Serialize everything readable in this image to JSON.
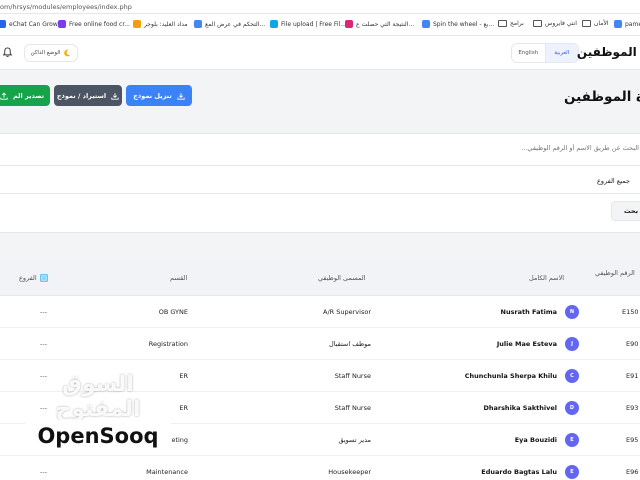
{
  "browser": {
    "url": "om/hrsys/modules/employees/index.php",
    "bookmarks": [
      {
        "label": "eChat Can Grow...",
        "icon": "page-icon",
        "color": "#2563eb"
      },
      {
        "label": "Free online food cr...",
        "icon": "bird-icon",
        "color": "#7c3aed"
      },
      {
        "label": "مداد العليد: بلوجر",
        "icon": "page-icon",
        "color": "#f59e0b"
      },
      {
        "label": "التحكم في عرض المع...",
        "icon": "google-icon",
        "color": "#4285f4"
      },
      {
        "label": "File upload | Free Fil...",
        "icon": "page-icon",
        "color": "#0ea5e9"
      },
      {
        "label": "النتيجة التي حصلت ع...",
        "icon": "page-icon",
        "color": "#db2777"
      },
      {
        "label": "Spin the wheel - بع...",
        "icon": "google-icon",
        "color": "#4285f4"
      },
      {
        "label": "برامج",
        "icon": "folder-icon",
        "color": "#555555"
      },
      {
        "label": "انتي فايروس",
        "icon": "folder-icon",
        "color": "#555555"
      },
      {
        "label": "الأمان",
        "icon": "folder-icon",
        "color": "#555555"
      },
      {
        "label": "pame",
        "icon": "google-icon",
        "color": "#4285f4"
      }
    ]
  },
  "header": {
    "title": "ة الموظفين",
    "dark_mode_label": "الوضع الداكن",
    "lang_english": "English",
    "lang_arabic": "العربية"
  },
  "actions": {
    "export_label": "تصدير الم",
    "import_label": "استيراد / نموذج",
    "download_label": "تنزيل نموذج"
  },
  "page": {
    "title": "ة الموظفين"
  },
  "filters": {
    "search_placeholder": "البحث عن طريق الاسم أو الرقم الوظيفي...",
    "branch_value": "جميع الفروع",
    "search_button": "بحث"
  },
  "table": {
    "headers": {
      "empno": "الرقم الوظيفي",
      "name": "الاسم الكامل",
      "title": "المسمى الوظيفي",
      "dept": "القسم",
      "branches": "الفروع"
    },
    "rows": [
      {
        "empno": "E150",
        "initial": "N",
        "name": "Nusrath Fatima",
        "title": "A/R Supervisor",
        "dept": "OB GYNE",
        "branches": "---"
      },
      {
        "empno": "E90",
        "initial": "J",
        "name": "Julie Mae Esteva",
        "title": "موظف استقبال",
        "dept": "Registration",
        "branches": "---"
      },
      {
        "empno": "E91",
        "initial": "C",
        "name": "Chunchunla Sherpa Khilu",
        "title": "Staff Nurse",
        "dept": "ER",
        "branches": "---"
      },
      {
        "empno": "E93",
        "initial": "D",
        "name": "Dharshika Sakthivel",
        "title": "Staff Nurse",
        "dept": "ER",
        "branches": "---"
      },
      {
        "empno": "E95",
        "initial": "E",
        "name": "Eya Bouzidi",
        "title": "مدير تسويق",
        "dept": "keting",
        "branches": ""
      },
      {
        "empno": "E96",
        "initial": "E",
        "name": "Eduardo Bagtas Lalu",
        "title": "Housekeeper",
        "dept": "Maintenance",
        "branches": "---"
      }
    ]
  },
  "watermark": {
    "arabic": "السوق المفتوح",
    "english": "OpenSooq"
  }
}
